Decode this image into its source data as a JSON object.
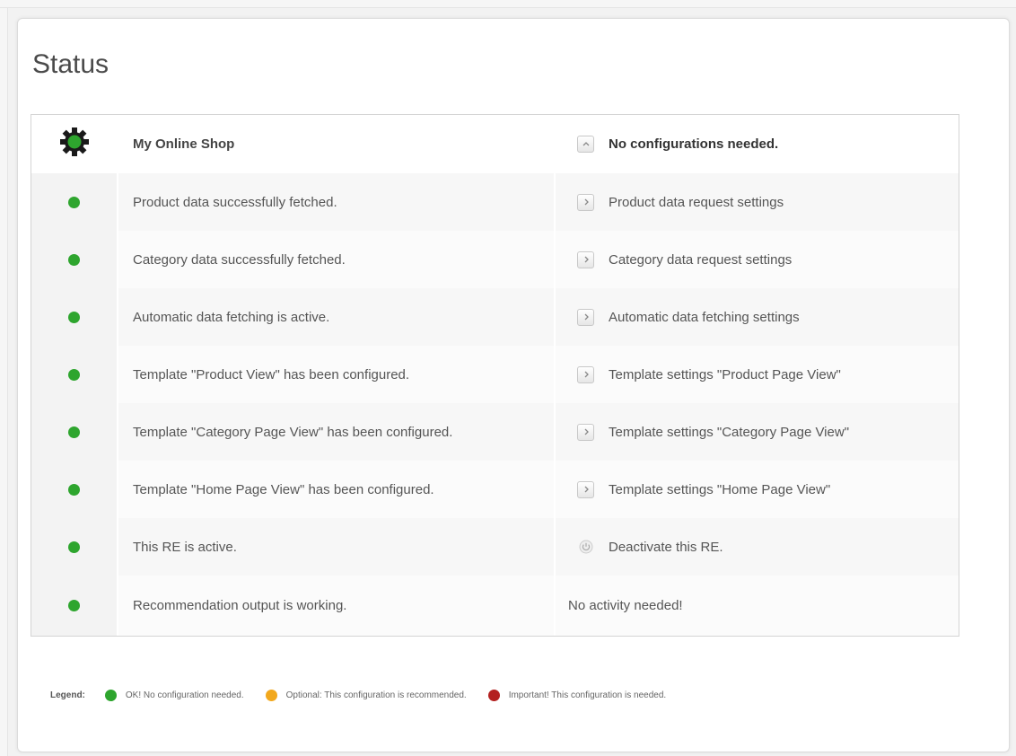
{
  "page": {
    "title": "Status"
  },
  "colors": {
    "ok": "#2ea52e",
    "optional": "#f2a81d",
    "important": "#b3201f"
  },
  "header": {
    "shop_name": "My Online Shop",
    "config_status": "No configurations needed.",
    "header_icon": "gear-icon",
    "toggle_icon": "chevron-up-icon"
  },
  "rows": [
    {
      "status": "ok",
      "message": "Product data successfully fetched.",
      "action": "Product data request settings",
      "action_icon": "chevron-right-icon"
    },
    {
      "status": "ok",
      "message": "Category data successfully fetched.",
      "action": "Category data request settings",
      "action_icon": "chevron-right-icon"
    },
    {
      "status": "ok",
      "message": "Automatic data fetching is active.",
      "action": "Automatic data fetching settings",
      "action_icon": "chevron-right-icon"
    },
    {
      "status": "ok",
      "message": "Template \"Product View\" has been configured.",
      "action": "Template settings \"Product Page View\"",
      "action_icon": "chevron-right-icon"
    },
    {
      "status": "ok",
      "message": "Template \"Category Page View\" has been configured.",
      "action": "Template settings \"Category Page View\"",
      "action_icon": "chevron-right-icon"
    },
    {
      "status": "ok",
      "message": "Template \"Home Page View\" has been configured.",
      "action": "Template settings \"Home Page View\"",
      "action_icon": "chevron-right-icon"
    },
    {
      "status": "ok",
      "message": "This RE is active.",
      "action": "Deactivate this RE.",
      "action_icon": "power-icon"
    },
    {
      "status": "ok",
      "message": "Recommendation output is working.",
      "action": "No activity needed!",
      "action_icon": ""
    }
  ],
  "legend": {
    "title": "Legend:",
    "items": [
      {
        "label": "OK! No configuration needed.",
        "color_key": "ok"
      },
      {
        "label": "Optional: This configuration is recommended.",
        "color_key": "optional"
      },
      {
        "label": "Important! This configuration is needed.",
        "color_key": "important"
      }
    ]
  }
}
